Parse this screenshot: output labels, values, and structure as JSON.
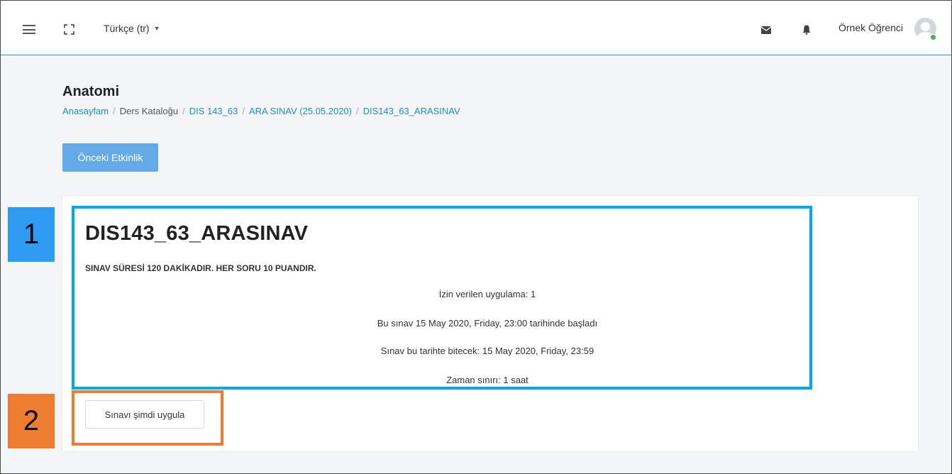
{
  "navbar": {
    "language": "Türkçe (tr)",
    "user_name": "Örnek Öğrenci"
  },
  "page": {
    "title": "Anatomi",
    "breadcrumb": [
      {
        "label": "Anasayfam",
        "link": true
      },
      {
        "label": "Ders Kataloğu",
        "link": false
      },
      {
        "label": "DIS 143_63",
        "link": true
      },
      {
        "label": "ARA SINAV (25.05.2020)",
        "link": true
      },
      {
        "label": "DIS143_63_ARASINAV",
        "link": true
      }
    ],
    "prev_activity_label": "Önceki Etkinlik"
  },
  "quiz": {
    "title": "DIS143_63_ARASINAV",
    "description": "SINAV SÜRESİ 120 DAKİKADIR. HER SORU 10 PUANDIR.",
    "info": [
      "İzin verilen uygulama: 1",
      "Bu sınav 15 May 2020, Friday, 23:00 tarihinde başladı",
      "Sınav bu tarihte bitecek: 15 May 2020, Friday, 23:59",
      "Zaman sınırı: 1 saat"
    ],
    "attempt_label": "Sınavı şimdi uygula"
  },
  "annotations": {
    "label_1": "1",
    "label_2": "2",
    "colors": {
      "blue": "#00aaea",
      "orange": "#ee7d31",
      "label_blue": "#2d9bf0"
    }
  },
  "icons": [
    "menu-icon",
    "fullscreen-icon",
    "caret-down-icon",
    "mail-icon",
    "bell-icon",
    "avatar-icon"
  ],
  "colors": {
    "accent": "#29a0c8",
    "link": "#1e8fb5",
    "primary_button": "#64a9e8",
    "online": "#4caf50"
  }
}
